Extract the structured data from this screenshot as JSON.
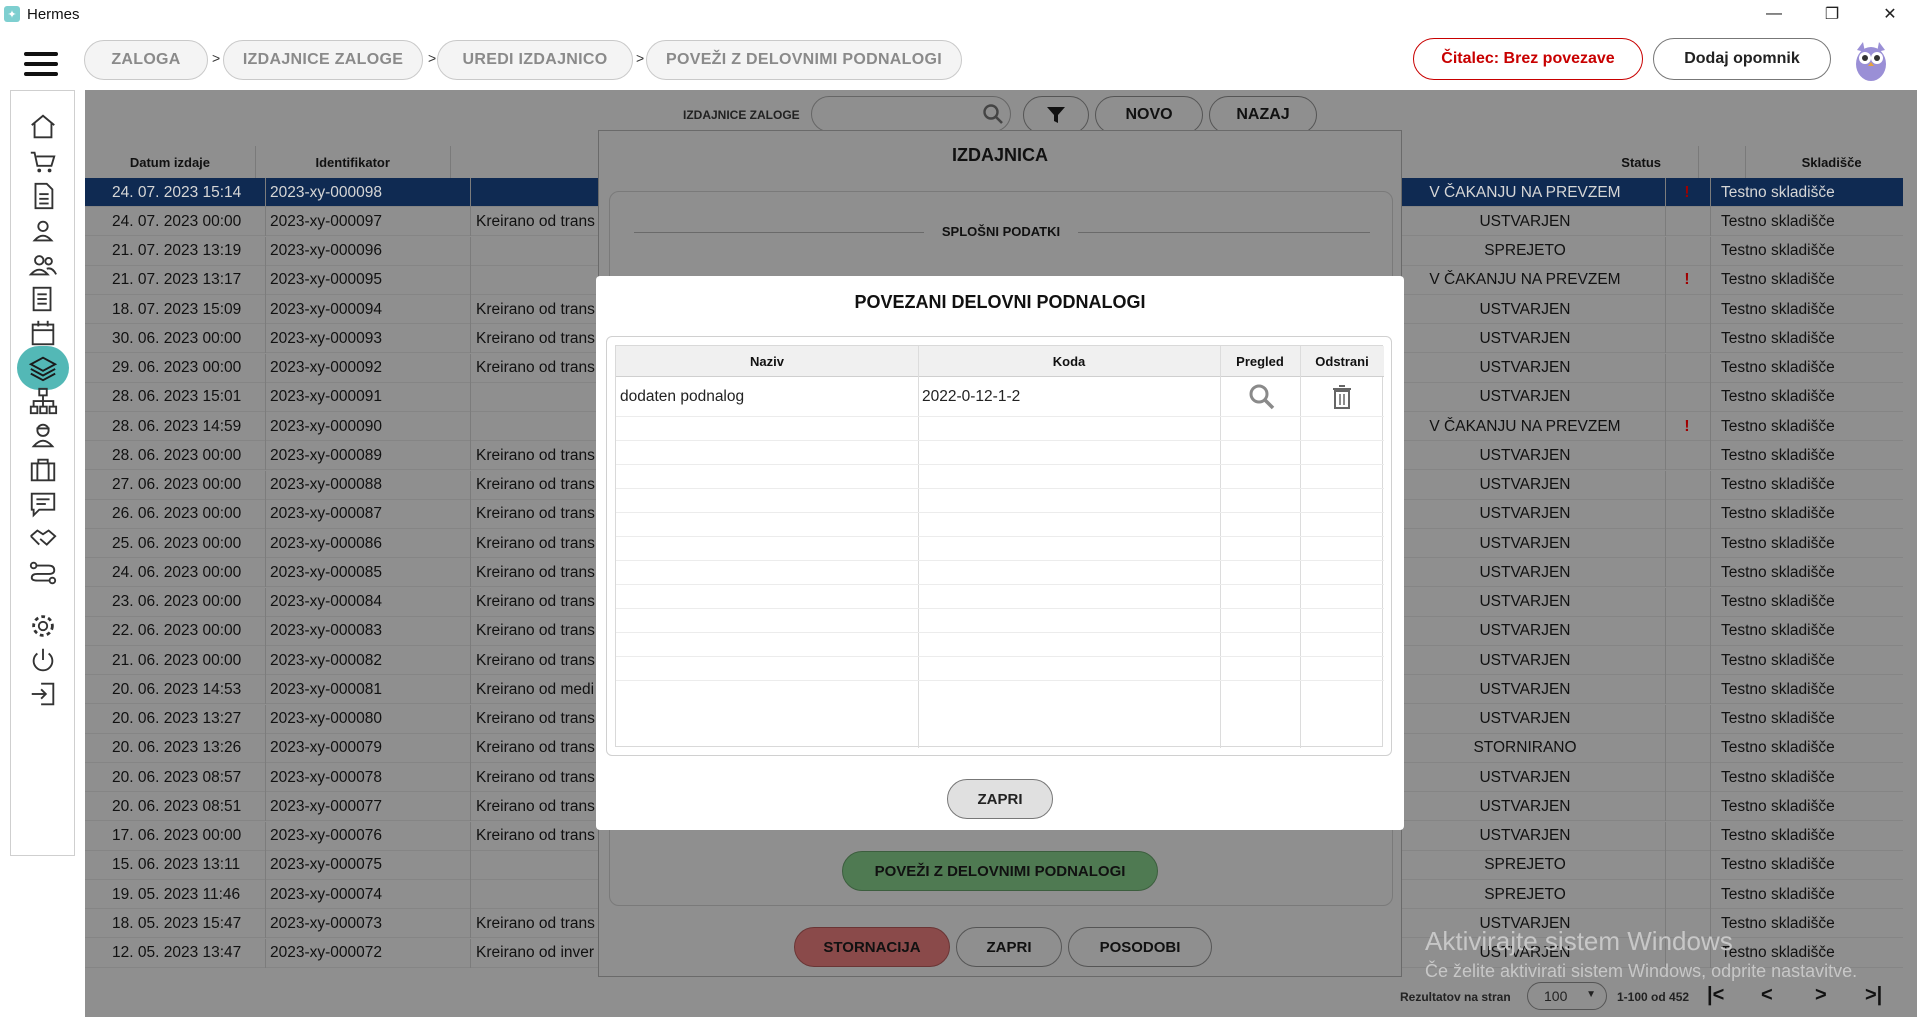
{
  "window": {
    "title": "Hermes",
    "minimize": "—",
    "maximize": "❐",
    "close": "✕"
  },
  "breadcrumbs": [
    "ZALOGA",
    "IZDAJNICE ZALOGE",
    "UREDI IZDAJNICO",
    "POVEŽI Z DELOVNIMI PODNALOGI"
  ],
  "breadcrumb_separator": ">",
  "header": {
    "reader_label": "Čitalec: Brez povezave",
    "reminder_label": "Dodaj opomnik"
  },
  "sidebar": {
    "items": [
      {
        "icon": "home-icon"
      },
      {
        "icon": "cart-icon"
      },
      {
        "icon": "document-icon"
      },
      {
        "icon": "user-icon"
      },
      {
        "icon": "users-icon"
      },
      {
        "icon": "list-document-icon"
      },
      {
        "icon": "calendar-icon"
      },
      {
        "icon": "layers-icon",
        "active": true
      },
      {
        "icon": "hierarchy-icon"
      },
      {
        "icon": "worker-icon"
      },
      {
        "icon": "briefcase-icon"
      },
      {
        "icon": "chat-icon"
      },
      {
        "icon": "handshake-icon"
      },
      {
        "icon": "route-icon"
      },
      {
        "icon": "gear-icon"
      },
      {
        "icon": "power-icon"
      },
      {
        "icon": "logout-icon"
      }
    ],
    "active_color": "#53b8b6"
  },
  "toolbar": {
    "search_label": "IZDAJNICE ZALOGE",
    "search_value": "",
    "new_label": "NOVO",
    "back_label": "NAZAJ"
  },
  "grid": {
    "headers": {
      "date": "Datum izdaje",
      "id": "Identifikator",
      "status": "Status",
      "warehouse": "Skladišče"
    },
    "rows": [
      {
        "date": "24. 07. 2023 15:14",
        "id": "2023-xy-000098",
        "desc": "",
        "status": "V ČAKANJU NA PREVZEM",
        "warn": "!",
        "wh": "Testno skladišče",
        "selected": true
      },
      {
        "date": "24. 07. 2023 00:00",
        "id": "2023-xy-000097",
        "desc": "Kreirano od trans",
        "status": "USTVARJEN",
        "warn": "",
        "wh": "Testno skladišče"
      },
      {
        "date": "21. 07. 2023 13:19",
        "id": "2023-xy-000096",
        "desc": "",
        "status": "SPREJETO",
        "warn": "",
        "wh": "Testno skladišče"
      },
      {
        "date": "21. 07. 2023 13:17",
        "id": "2023-xy-000095",
        "desc": "",
        "status": "V ČAKANJU NA PREVZEM",
        "warn": "!",
        "wh": "Testno skladišče"
      },
      {
        "date": "18. 07. 2023 15:09",
        "id": "2023-xy-000094",
        "desc": "Kreirano od trans",
        "status": "USTVARJEN",
        "warn": "",
        "wh": "Testno skladišče"
      },
      {
        "date": "30. 06. 2023 00:00",
        "id": "2023-xy-000093",
        "desc": "Kreirano od trans",
        "status": "USTVARJEN",
        "warn": "",
        "wh": "Testno skladišče"
      },
      {
        "date": "29. 06. 2023 00:00",
        "id": "2023-xy-000092",
        "desc": "Kreirano od trans",
        "status": "USTVARJEN",
        "warn": "",
        "wh": "Testno skladišče"
      },
      {
        "date": "28. 06. 2023 15:01",
        "id": "2023-xy-000091",
        "desc": "",
        "status": "USTVARJEN",
        "warn": "",
        "wh": "Testno skladišče"
      },
      {
        "date": "28. 06. 2023 14:59",
        "id": "2023-xy-000090",
        "desc": "",
        "status": "V ČAKANJU NA PREVZEM",
        "warn": "!",
        "wh": "Testno skladišče"
      },
      {
        "date": "28. 06. 2023 00:00",
        "id": "2023-xy-000089",
        "desc": "Kreirano od trans",
        "status": "USTVARJEN",
        "warn": "",
        "wh": "Testno skladišče"
      },
      {
        "date": "27. 06. 2023 00:00",
        "id": "2023-xy-000088",
        "desc": "Kreirano od trans",
        "status": "USTVARJEN",
        "warn": "",
        "wh": "Testno skladišče"
      },
      {
        "date": "26. 06. 2023 00:00",
        "id": "2023-xy-000087",
        "desc": "Kreirano od trans",
        "status": "USTVARJEN",
        "warn": "",
        "wh": "Testno skladišče"
      },
      {
        "date": "25. 06. 2023 00:00",
        "id": "2023-xy-000086",
        "desc": "Kreirano od trans",
        "status": "USTVARJEN",
        "warn": "",
        "wh": "Testno skladišče"
      },
      {
        "date": "24. 06. 2023 00:00",
        "id": "2023-xy-000085",
        "desc": "Kreirano od trans",
        "status": "USTVARJEN",
        "warn": "",
        "wh": "Testno skladišče"
      },
      {
        "date": "23. 06. 2023 00:00",
        "id": "2023-xy-000084",
        "desc": "Kreirano od trans",
        "status": "USTVARJEN",
        "warn": "",
        "wh": "Testno skladišče"
      },
      {
        "date": "22. 06. 2023 00:00",
        "id": "2023-xy-000083",
        "desc": "Kreirano od trans",
        "status": "USTVARJEN",
        "warn": "",
        "wh": "Testno skladišče"
      },
      {
        "date": "21. 06. 2023 00:00",
        "id": "2023-xy-000082",
        "desc": "Kreirano od trans",
        "status": "USTVARJEN",
        "warn": "",
        "wh": "Testno skladišče"
      },
      {
        "date": "20. 06. 2023 14:53",
        "id": "2023-xy-000081",
        "desc": "Kreirano od medi",
        "status": "USTVARJEN",
        "warn": "",
        "wh": "Testno skladišče"
      },
      {
        "date": "20. 06. 2023 13:27",
        "id": "2023-xy-000080",
        "desc": "Kreirano od trans",
        "status": "USTVARJEN",
        "warn": "",
        "wh": "Testno skladišče"
      },
      {
        "date": "20. 06. 2023 13:26",
        "id": "2023-xy-000079",
        "desc": "Kreirano od trans",
        "status": "STORNIRANO",
        "warn": "",
        "wh": "Testno skladišče"
      },
      {
        "date": "20. 06. 2023 08:57",
        "id": "2023-xy-000078",
        "desc": "Kreirano od trans",
        "status": "USTVARJEN",
        "warn": "",
        "wh": "Testno skladišče"
      },
      {
        "date": "20. 06. 2023 08:51",
        "id": "2023-xy-000077",
        "desc": "Kreirano od trans",
        "status": "USTVARJEN",
        "warn": "",
        "wh": "Testno skladišče"
      },
      {
        "date": "17. 06. 2023 00:00",
        "id": "2023-xy-000076",
        "desc": "Kreirano od trans",
        "status": "USTVARJEN",
        "warn": "",
        "wh": "Testno skladišče"
      },
      {
        "date": "15. 06. 2023 13:11",
        "id": "2023-xy-000075",
        "desc": "",
        "status": "SPREJETO",
        "warn": "",
        "wh": "Testno skladišče"
      },
      {
        "date": "19. 05. 2023 11:46",
        "id": "2023-xy-000074",
        "desc": "",
        "status": "SPREJETO",
        "warn": "",
        "wh": "Testno skladišče"
      },
      {
        "date": "18. 05. 2023 15:47",
        "id": "2023-xy-000073",
        "desc": "Kreirano od trans",
        "status": "USTVARJEN",
        "warn": "",
        "wh": "Testno skladišče"
      },
      {
        "date": "12. 05. 2023 13:47",
        "id": "2023-xy-000072",
        "desc": "Kreirano od inver",
        "status": "USTVARJEN",
        "warn": "",
        "wh": "Testno skladišče"
      }
    ]
  },
  "footer": {
    "per_page_label": "Rezultatov na stran",
    "per_page_value": "100",
    "range": "1-100 od 452",
    "first": "|<",
    "prev": "<",
    "next": ">",
    "last": ">|"
  },
  "watermark": {
    "line1": "Aktivirajte sistem Windows",
    "line2": "Če želite aktivirati sistem Windows, odprite nastavitve."
  },
  "outer_dialog": {
    "title": "IZDAJNICA",
    "section": "SPLOŠNI PODATKI",
    "link_label": "POVEŽI Z DELOVNIMI PODNALOGI",
    "storno_label": "STORNACIJA",
    "close_label": "ZAPRI",
    "update_label": "POSODOBI"
  },
  "inner_dialog": {
    "title": "POVEZANI DELOVNI PODNALOGI",
    "headers": {
      "name": "Naziv",
      "code": "Koda",
      "preview": "Pregled",
      "remove": "Odstrani"
    },
    "rows": [
      {
        "name": "dodaten podnalog",
        "code": "2022-0-12-1-2"
      }
    ],
    "close_label": "ZAPRI"
  }
}
